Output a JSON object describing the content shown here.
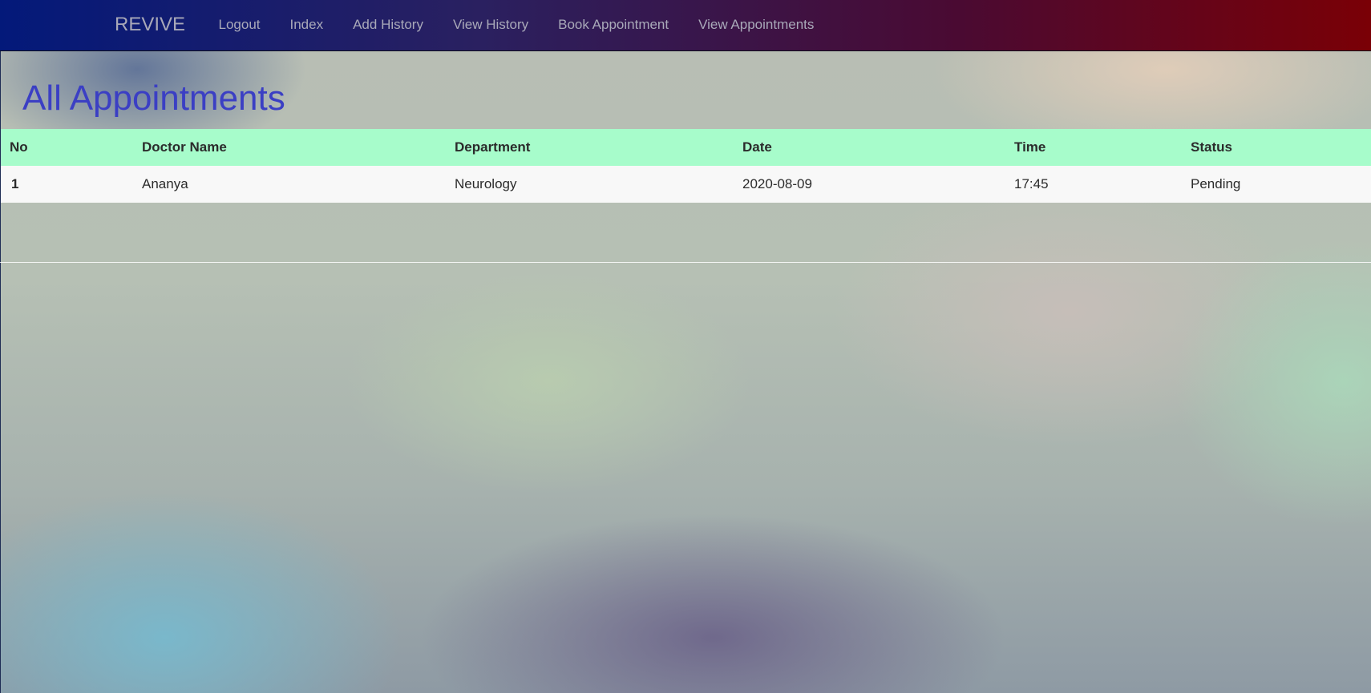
{
  "navbar": {
    "brand": "REVIVE",
    "links": [
      "Logout",
      "Index",
      "Add History",
      "View History",
      "Book Appointment",
      "View Appointments"
    ]
  },
  "page": {
    "title": "All Appointments"
  },
  "table": {
    "headers": [
      "No",
      "Doctor Name",
      "Department",
      "Date",
      "Time",
      "Status"
    ],
    "rows": [
      [
        "1",
        "Ananya",
        "Neurology",
        "2020-08-09",
        "17:45",
        "Pending"
      ]
    ]
  },
  "colors": {
    "nav_gradient_start": "#03197a",
    "nav_gradient_end": "#7a0006",
    "title": "#3b3fc4",
    "table_header_bg": "#a7fccb",
    "table_row_bg": "#f8f8f8"
  }
}
